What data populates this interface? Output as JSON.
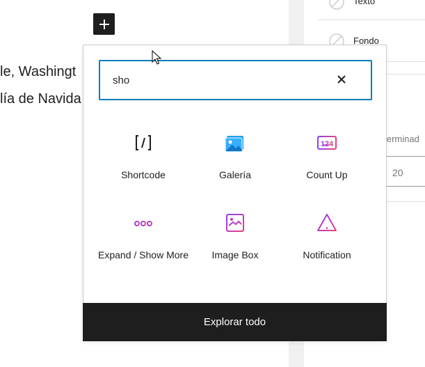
{
  "editor": {
    "line1": "le, Washingt",
    "line2": "lía de Navida"
  },
  "sidebar": {
    "item_texto": "Texto",
    "item_fondo": "Fondo",
    "label_partial": "eterminad",
    "input_value": "20"
  },
  "inserter": {
    "search_value": "sho",
    "clear_label": "✕",
    "blocks": [
      {
        "label": "Shortcode",
        "icon": "shortcode-icon"
      },
      {
        "label": "Galería",
        "icon": "gallery-icon"
      },
      {
        "label": "Count Up",
        "icon": "count-up-icon"
      },
      {
        "label": "Expand / Show More",
        "icon": "expand-more-icon"
      },
      {
        "label": "Image Box",
        "icon": "image-box-icon"
      },
      {
        "label": "Notification",
        "icon": "notification-icon"
      }
    ],
    "footer_label": "Explorar todo"
  },
  "colors": {
    "accent": "#007cba",
    "dark": "#1e1e1e",
    "gallery_blue": "#1da1f2",
    "gradient_start": "#8a3ffc",
    "gradient_end": "#e8407a"
  }
}
